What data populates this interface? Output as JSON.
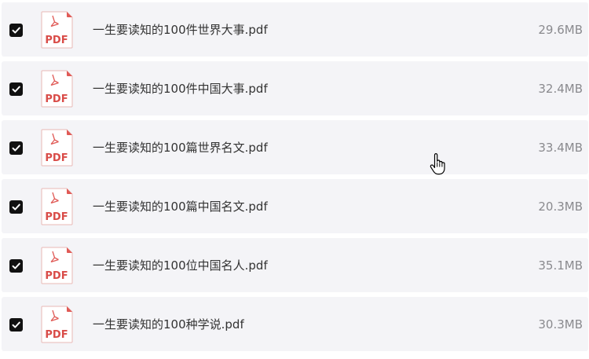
{
  "colors": {
    "row_background": "#f4f4f7",
    "checkbox": "#111111",
    "pdf_accent": "#e05a56",
    "name_text": "#333333",
    "size_text": "#8a8a8e"
  },
  "icons": {
    "checkbox": "checked-checkbox-icon",
    "file": "pdf-file-icon",
    "cursor": "hand-pointer-cursor-icon"
  },
  "files": [
    {
      "checked": true,
      "icon_label": "PDF",
      "name": "一生要读知的100件世界大事.pdf",
      "size": "29.6MB"
    },
    {
      "checked": true,
      "icon_label": "PDF",
      "name": "一生要读知的100件中国大事.pdf",
      "size": "32.4MB"
    },
    {
      "checked": true,
      "icon_label": "PDF",
      "name": "一生要读知的100篇世界名文.pdf",
      "size": "33.4MB"
    },
    {
      "checked": true,
      "icon_label": "PDF",
      "name": "一生要读知的100篇中国名文.pdf",
      "size": "20.3MB"
    },
    {
      "checked": true,
      "icon_label": "PDF",
      "name": "一生要读知的100位中国名人.pdf",
      "size": "35.1MB"
    },
    {
      "checked": true,
      "icon_label": "PDF",
      "name": "一生要读知的100种学说.pdf",
      "size": "30.3MB"
    }
  ]
}
